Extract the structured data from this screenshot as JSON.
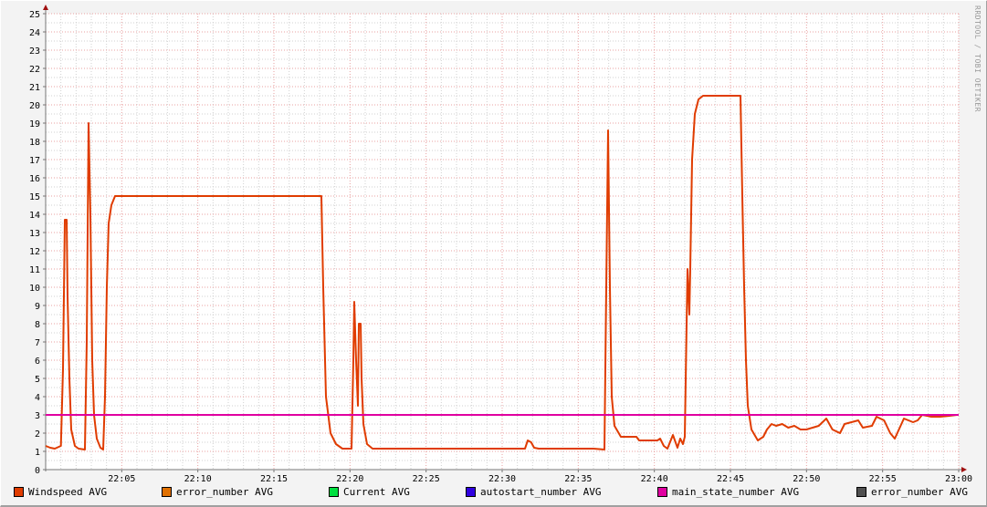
{
  "chart_data": {
    "type": "line",
    "title": "",
    "xlabel": "",
    "ylabel": "",
    "ylim": [
      0,
      25
    ],
    "xlim_minutes_after_22_00": [
      0,
      60
    ],
    "y_ticks": [
      "0",
      "1",
      "2",
      "3",
      "4",
      "5",
      "6",
      "7",
      "8",
      "9",
      "10",
      "11",
      "12",
      "13",
      "14",
      "15",
      "16",
      "17",
      "18",
      "19",
      "20",
      "21",
      "22",
      "23",
      "24",
      "25"
    ],
    "x_ticks": [
      {
        "label": "22:05",
        "minute": 5
      },
      {
        "label": "22:10",
        "minute": 10
      },
      {
        "label": "22:15",
        "minute": 15
      },
      {
        "label": "22:20",
        "minute": 20
      },
      {
        "label": "22:25",
        "minute": 25
      },
      {
        "label": "22:30",
        "minute": 30
      },
      {
        "label": "22:35",
        "minute": 35
      },
      {
        "label": "22:40",
        "minute": 40
      },
      {
        "label": "22:45",
        "minute": 45
      },
      {
        "label": "22:50",
        "minute": 50
      },
      {
        "label": "22:55",
        "minute": 55
      },
      {
        "label": "23:00",
        "minute": 60
      }
    ],
    "grid": true,
    "legend_position": "bottom",
    "watermark": "RRDTOOL / TOBI OETIKER",
    "series": [
      {
        "name": "Windspeed AVG",
        "color": "#e03c00",
        "points": [
          [
            0,
            1.3
          ],
          [
            0.3,
            1.2
          ],
          [
            0.6,
            1.15
          ],
          [
            1.0,
            1.3
          ],
          [
            1.14,
            5.5
          ],
          [
            1.26,
            13.7
          ],
          [
            1.38,
            13.7
          ],
          [
            1.44,
            9.5
          ],
          [
            1.56,
            5
          ],
          [
            1.68,
            2.2
          ],
          [
            1.92,
            1.3
          ],
          [
            2.16,
            1.15
          ],
          [
            2.58,
            1.1
          ],
          [
            2.7,
            7
          ],
          [
            2.82,
            19
          ],
          [
            2.94,
            14
          ],
          [
            3.06,
            6
          ],
          [
            3.18,
            3
          ],
          [
            3.36,
            1.7
          ],
          [
            3.6,
            1.2
          ],
          [
            3.78,
            1.1
          ],
          [
            3.9,
            4
          ],
          [
            4.02,
            10
          ],
          [
            4.14,
            13.5
          ],
          [
            4.32,
            14.5
          ],
          [
            4.56,
            15
          ],
          [
            18.12,
            15
          ],
          [
            18.24,
            10
          ],
          [
            18.42,
            4
          ],
          [
            18.72,
            2
          ],
          [
            19.08,
            1.4
          ],
          [
            19.5,
            1.15
          ],
          [
            20.1,
            1.15
          ],
          [
            20.22,
            6
          ],
          [
            20.28,
            9.2
          ],
          [
            20.4,
            6
          ],
          [
            20.52,
            3.5
          ],
          [
            20.58,
            8
          ],
          [
            20.7,
            8
          ],
          [
            20.76,
            5
          ],
          [
            20.88,
            2.5
          ],
          [
            21.12,
            1.4
          ],
          [
            21.48,
            1.15
          ],
          [
            31.5,
            1.15
          ],
          [
            31.68,
            1.6
          ],
          [
            31.9,
            1.5
          ],
          [
            32.1,
            1.2
          ],
          [
            32.4,
            1.15
          ],
          [
            36.0,
            1.15
          ],
          [
            36.72,
            1.1
          ],
          [
            36.84,
            10
          ],
          [
            36.96,
            18.6
          ],
          [
            37.08,
            10
          ],
          [
            37.2,
            4
          ],
          [
            37.38,
            2.4
          ],
          [
            37.8,
            1.8
          ],
          [
            38.82,
            1.8
          ],
          [
            39.0,
            1.6
          ],
          [
            40.2,
            1.6
          ],
          [
            40.38,
            1.7
          ],
          [
            40.62,
            1.3
          ],
          [
            40.86,
            1.15
          ],
          [
            41.22,
            1.9
          ],
          [
            41.52,
            1.2
          ],
          [
            41.7,
            1.7
          ],
          [
            41.88,
            1.4
          ],
          [
            42.0,
            1.8
          ],
          [
            42.12,
            8
          ],
          [
            42.18,
            11
          ],
          [
            42.3,
            8.5
          ],
          [
            42.36,
            11
          ],
          [
            42.48,
            17
          ],
          [
            42.66,
            19.5
          ],
          [
            42.9,
            20.3
          ],
          [
            43.2,
            20.5
          ],
          [
            45.66,
            20.5
          ],
          [
            45.78,
            15
          ],
          [
            45.9,
            10
          ],
          [
            46.02,
            6
          ],
          [
            46.14,
            3.5
          ],
          [
            46.38,
            2.2
          ],
          [
            46.8,
            1.6
          ],
          [
            47.16,
            1.8
          ],
          [
            47.4,
            2.2
          ],
          [
            47.7,
            2.5
          ],
          [
            48.0,
            2.4
          ],
          [
            48.4,
            2.5
          ],
          [
            48.8,
            2.3
          ],
          [
            49.2,
            2.4
          ],
          [
            49.6,
            2.2
          ],
          [
            50.0,
            2.2
          ],
          [
            50.4,
            2.3
          ],
          [
            50.8,
            2.4
          ],
          [
            51.3,
            2.8
          ],
          [
            51.7,
            2.2
          ],
          [
            52.2,
            2.0
          ],
          [
            52.5,
            2.5
          ],
          [
            53.4,
            2.7
          ],
          [
            53.7,
            2.3
          ],
          [
            54.3,
            2.4
          ],
          [
            54.6,
            2.9
          ],
          [
            55.1,
            2.7
          ],
          [
            55.5,
            2.0
          ],
          [
            55.8,
            1.7
          ],
          [
            56.4,
            2.8
          ],
          [
            57.0,
            2.6
          ],
          [
            57.3,
            2.7
          ],
          [
            57.6,
            3.0
          ],
          [
            58.2,
            2.9
          ],
          [
            58.8,
            2.9
          ],
          [
            59.4,
            2.95
          ],
          [
            59.9,
            3.0
          ]
        ]
      },
      {
        "name": "error_number AVG",
        "color": "#e07000",
        "points": []
      },
      {
        "name": "Current AVG",
        "color": "#00e040",
        "points": []
      },
      {
        "name": "autostart_number AVG",
        "color": "#3000e0",
        "points": []
      },
      {
        "name": "main_state_number AVG",
        "color": "#e000a0",
        "points": [
          [
            0,
            3
          ],
          [
            60,
            3
          ]
        ]
      },
      {
        "name": "error_number AVG",
        "color": "#505050",
        "points": []
      }
    ]
  }
}
